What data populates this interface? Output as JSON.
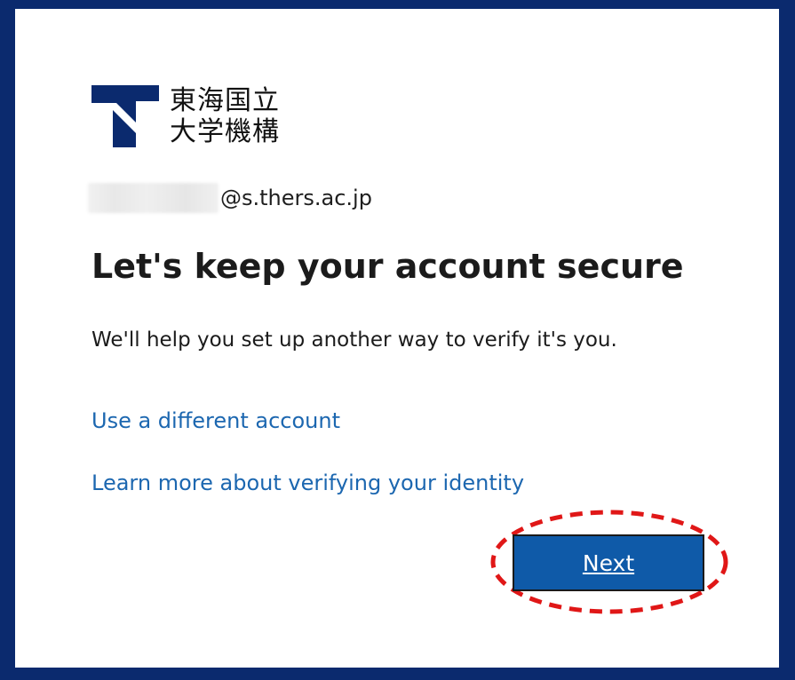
{
  "brand": {
    "logo_line1": "東海国立",
    "logo_line2": "大学機構",
    "logo_color": "#0b2a6e"
  },
  "identity": {
    "username_redacted": "",
    "domain": "@s.thers.ac.jp"
  },
  "page": {
    "title": "Let's keep your account secure",
    "description": "We'll help you set up another way to verify it's you."
  },
  "links": {
    "different_account": "Use a different account",
    "learn_more": "Learn more about verifying your identity"
  },
  "actions": {
    "next_label": "Next"
  },
  "colors": {
    "page_border": "#0b2a6e",
    "link": "#1c67b0",
    "button": "#0f5aa8",
    "highlight": "#e01717"
  }
}
